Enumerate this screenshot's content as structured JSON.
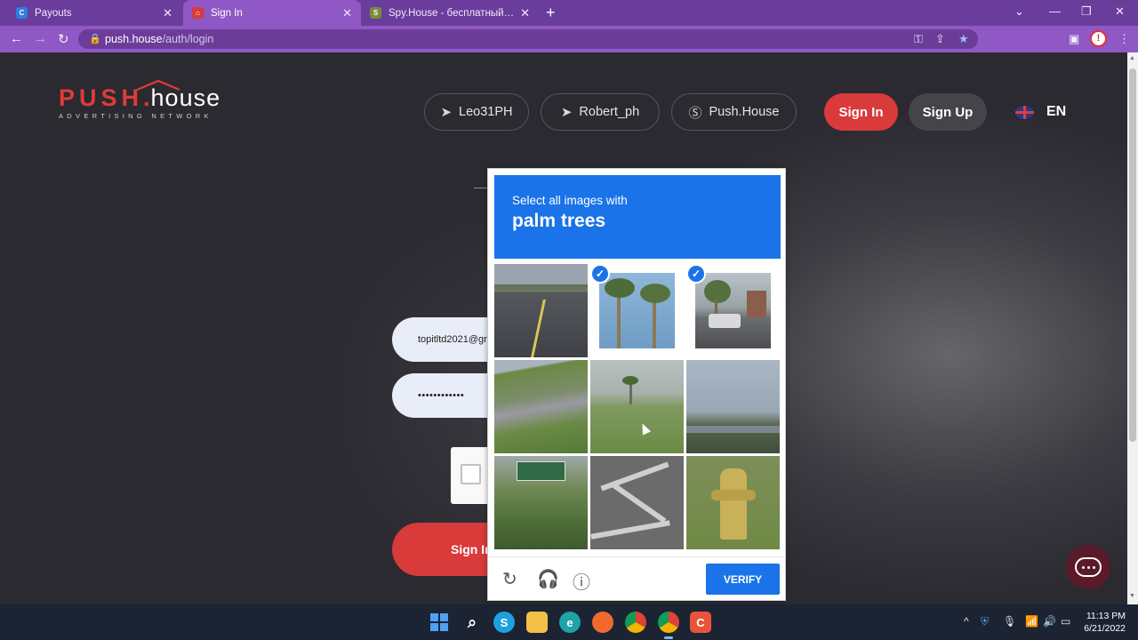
{
  "browser": {
    "tabs": [
      {
        "label": "Payouts",
        "fav_color": "#2f7de1",
        "fav_glyph": "C"
      },
      {
        "label": "Sign In",
        "fav_color": "#d93a3a",
        "fav_glyph": "⌂",
        "active": true
      },
      {
        "label": "Spy.House - бесплатный сервис",
        "fav_color": "#7b8c3c",
        "fav_glyph": "S"
      }
    ],
    "url_host": "push.house",
    "url_path": "/auth/login"
  },
  "site": {
    "logo_word_push": "PUSH",
    "logo_dot": ".",
    "logo_word_house": "house",
    "logo_tagline": "ADVERTISING NETWORK",
    "contacts": [
      {
        "label": "Leo31PH",
        "icon": "telegram-icon"
      },
      {
        "label": "Robert_ph",
        "icon": "telegram-icon"
      },
      {
        "label": "Push.House",
        "icon": "skype-icon"
      }
    ],
    "sign_in_label": "Sign In",
    "sign_up_label": "Sign Up",
    "language": "EN",
    "accent": "#d93a3a"
  },
  "login": {
    "email_value": "topitltd2021@gm",
    "password_value": "••••••••••••",
    "submit_label": "Sign In"
  },
  "captcha": {
    "instruction": "Select all images with",
    "target": "palm trees",
    "tiles": [
      {
        "name": "road",
        "selected": false
      },
      {
        "name": "palm-trees",
        "selected": true
      },
      {
        "name": "street-palms",
        "selected": true
      },
      {
        "name": "highway-grass",
        "selected": false
      },
      {
        "name": "bushes-palm",
        "selected": false
      },
      {
        "name": "overpass",
        "selected": false
      },
      {
        "name": "sign-bushes",
        "selected": false
      },
      {
        "name": "crosswalk",
        "selected": false
      },
      {
        "name": "hydrant",
        "selected": false
      }
    ],
    "verify_label": "VERIFY",
    "accent": "#1a73e8"
  },
  "taskbar": {
    "time": "11:13 PM",
    "date": "6/21/2022"
  }
}
